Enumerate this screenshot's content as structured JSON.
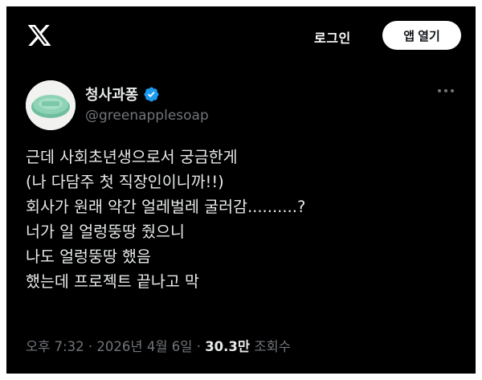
{
  "header": {
    "logo_icon": "x-logo-icon",
    "login_label": "로그인",
    "open_app_label": "앱 열기"
  },
  "author": {
    "display_name": "청사과퐁",
    "verified": true,
    "verified_icon": "verified-badge-icon",
    "verified_color": "#1d9bf0",
    "handle": "@greenapplesoap",
    "avatar_icon": "green-soap-avatar"
  },
  "more_icon": "more-options-icon",
  "tweet": {
    "lines": [
      "근데 사회초년생으로서 궁금한게",
      "(나 다담주 첫 직장인이니까!!)",
      "회사가 원래 약간 얼레벌레 굴러감..........?",
      "너가 일 얼렁뚱땅 줬으니",
      "나도 얼렁뚱땅 했음",
      "했는데 프로젝트 끝나고 막"
    ]
  },
  "meta": {
    "time": "오후 7:32",
    "separator": "·",
    "date": "2026년 4월 6일",
    "views_count": "30.3만",
    "views_label": "조회수"
  },
  "colors": {
    "background": "#000000",
    "text_primary": "#e7e9ea",
    "text_secondary": "#71767b",
    "button_bg": "#ffffff"
  }
}
